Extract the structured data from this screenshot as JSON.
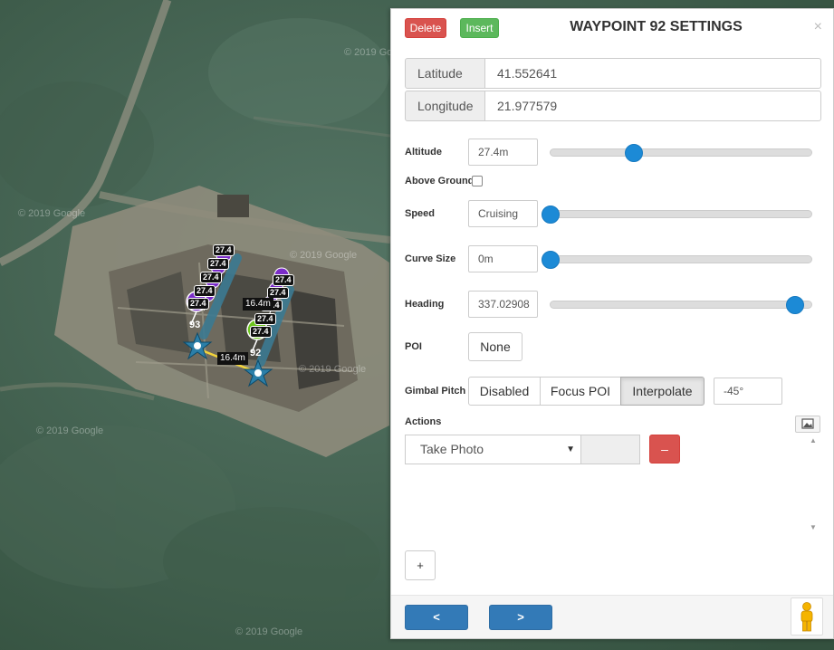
{
  "map": {
    "watermarks": [
      "© 2019 Google",
      "© 2019 Google",
      "© 2019 Google",
      "© 2019 Google",
      "© 2019 Google",
      "© 2019 Google"
    ],
    "altitude_tags": [
      "27.4",
      "27.4",
      "27.4",
      "27.4",
      "27.4",
      "27.4",
      "27.4",
      "27.4",
      "27.4",
      "27.4",
      "27.4"
    ],
    "distance_labels": [
      "16.4m",
      "16.4m"
    ],
    "waypoints": [
      {
        "label": "93",
        "color": "#7b2cc9"
      },
      {
        "label": "92",
        "color": "#6cc51d"
      }
    ]
  },
  "panel": {
    "title": "WAYPOINT 92 SETTINGS",
    "close": "×",
    "delete_label": "Delete",
    "insert_label": "Insert",
    "latitude_label": "Latitude",
    "latitude_value": "41.552641",
    "longitude_label": "Longitude",
    "longitude_value": "21.977579",
    "altitude": {
      "label": "Altitude",
      "value": "27.4m",
      "slider_fraction": 0.32
    },
    "above_ground": {
      "label": "Above Ground",
      "checked": false
    },
    "speed": {
      "label": "Speed",
      "value": "Cruising",
      "slider_fraction": 0.0
    },
    "curve_size": {
      "label": "Curve Size",
      "value": "0m",
      "slider_fraction": 0.0
    },
    "heading": {
      "label": "Heading",
      "value": "337.02908",
      "slider_fraction": 0.936
    },
    "poi": {
      "label": "POI",
      "value": "None"
    },
    "gimbal_pitch": {
      "label": "Gimbal Pitch",
      "options": [
        "Disabled",
        "Focus POI",
        "Interpolate"
      ],
      "selected": "Interpolate",
      "value": "-45°"
    },
    "actions": {
      "label": "Actions",
      "items": [
        {
          "action": "Take Photo",
          "param": ""
        }
      ],
      "remove_label": "–",
      "add_label": "+",
      "scroll_up": "▲",
      "scroll_down": "▼"
    },
    "nav": {
      "prev": "<",
      "next": ">"
    }
  },
  "colors": {
    "accent": "#1c8ad6",
    "danger": "#d9534f",
    "success": "#5cb85c",
    "primary": "#337ab7"
  }
}
